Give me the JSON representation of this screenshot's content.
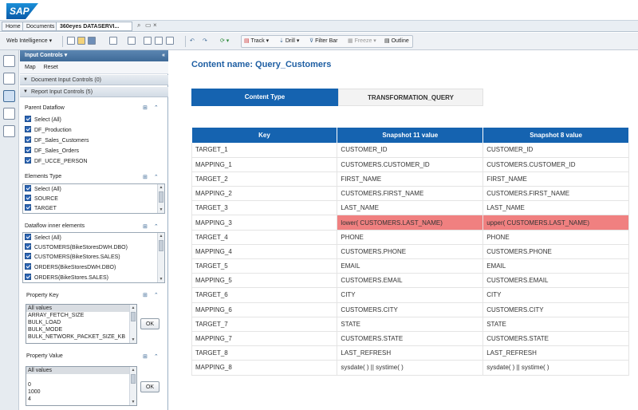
{
  "app": {
    "logo": "SAP"
  },
  "tabs": [
    {
      "label": "Home"
    },
    {
      "label": "Documents"
    },
    {
      "label": "360eyes DATASERVI..."
    }
  ],
  "toolbar": {
    "mode": "Web Intelligence",
    "track": "Track",
    "drill": "Drill",
    "filter_bar": "Filter Bar",
    "freeze": "Freeze",
    "outline": "Outline"
  },
  "panel": {
    "title": "Input Controls",
    "map": "Map",
    "reset": "Reset",
    "doc_controls": "Document Input Controls (0)",
    "report_controls": "Report Input Controls (5)",
    "parent_dataflow": {
      "title": "Parent Dataflow",
      "items": [
        "Select (All)",
        "DF_Production",
        "DF_Sales_Customers",
        "DF_Sales_Orders",
        "DF_UCCE_PERSON"
      ]
    },
    "elements_type": {
      "title": "Elements Type",
      "items": [
        "Select (All)",
        "SOURCE",
        "TARGET"
      ]
    },
    "dataflow_inner": {
      "title": "Dataflow inner elements",
      "items": [
        "Select (All)",
        "CUSTOMERS(BikeStoresDWH.DBO)",
        "CUSTOMERS(BikeStores.SALES)",
        "ORDERS(BikeStoresDWH.DBO)",
        "ORDERS(BikeStores.SALES)"
      ]
    },
    "property_key": {
      "title": "Property Key",
      "options": [
        "All values",
        "ARRAY_FETCH_SIZE",
        "BULK_LOAD",
        "BULK_MODE",
        "BULK_NETWORK_PACKET_SIZE_KB"
      ],
      "ok": "OK"
    },
    "property_value": {
      "title": "Property Value",
      "options": [
        "All values",
        "",
        "0",
        "1000",
        "4"
      ],
      "ok": "OK"
    }
  },
  "main": {
    "content_name": "Content name: Query_Customers",
    "tab_active": "Content Type",
    "tab_inactive": "TRANSFORMATION_QUERY",
    "columns": [
      "Key",
      "Snapshot 11 value",
      "Snapshot 8 value"
    ],
    "rows": [
      [
        "TARGET_1",
        "CUSTOMER_ID",
        "CUSTOMER_ID"
      ],
      [
        "MAPPING_1",
        "CUSTOMERS.CUSTOMER_ID",
        "CUSTOMERS.CUSTOMER_ID"
      ],
      [
        "TARGET_2",
        "FIRST_NAME",
        "FIRST_NAME"
      ],
      [
        "MAPPING_2",
        "CUSTOMERS.FIRST_NAME",
        "CUSTOMERS.FIRST_NAME"
      ],
      [
        "TARGET_3",
        "LAST_NAME",
        "LAST_NAME"
      ],
      [
        "MAPPING_3",
        "lower( CUSTOMERS.LAST_NAME)",
        "upper( CUSTOMERS.LAST_NAME)"
      ],
      [
        "TARGET_4",
        "PHONE",
        "PHONE"
      ],
      [
        "MAPPING_4",
        "CUSTOMERS.PHONE",
        "CUSTOMERS.PHONE"
      ],
      [
        "TARGET_5",
        "EMAIL",
        "EMAIL"
      ],
      [
        "MAPPING_5",
        "CUSTOMERS.EMAIL",
        "CUSTOMERS.EMAIL"
      ],
      [
        "TARGET_6",
        "CITY",
        "CITY"
      ],
      [
        "MAPPING_6",
        "CUSTOMERS.CITY",
        "CUSTOMERS.CITY"
      ],
      [
        "TARGET_7",
        "STATE",
        "STATE"
      ],
      [
        "MAPPING_7",
        "CUSTOMERS.STATE",
        "CUSTOMERS.STATE"
      ],
      [
        "TARGET_8",
        "LAST_REFRESH",
        "LAST_REFRESH"
      ],
      [
        "MAPPING_8",
        "sysdate( ) || systime( )",
        "sysdate( ) || systime( )"
      ]
    ],
    "highlight_row": 5,
    "highlight_color": "#f08080",
    "accent": "#1563b0"
  }
}
